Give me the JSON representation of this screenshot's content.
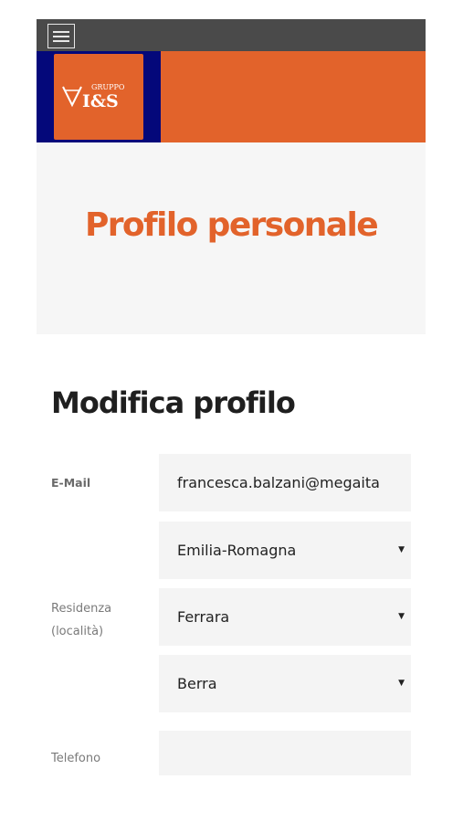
{
  "header": {
    "menu_icon": "hamburger-icon",
    "logo": {
      "top_text": "GRUPPO",
      "main_text": "VI&S"
    },
    "colors": {
      "topbar": "#4a4a4a",
      "brand_orange": "#e2632b",
      "brand_navy": "#04087a"
    }
  },
  "hero": {
    "title": "Profilo personale"
  },
  "form": {
    "title": "Modifica profilo",
    "email": {
      "label": "E-Mail",
      "value": "francesca.balzani@megaita"
    },
    "residence": {
      "label_line1": "Residenza",
      "label_line2": "(località)",
      "region": "Emilia-Romagna",
      "province": "Ferrara",
      "town": "Berra",
      "dropdown_icon": "caret-down-icon"
    },
    "phone": {
      "label": "Telefono",
      "value": ""
    }
  }
}
